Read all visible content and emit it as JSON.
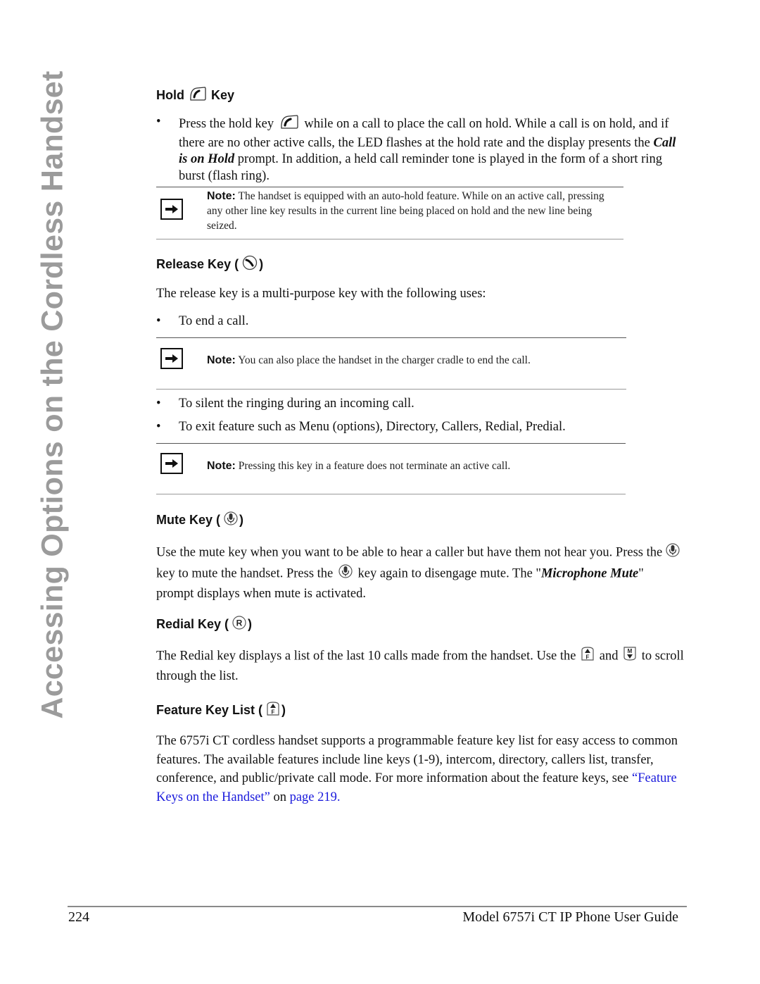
{
  "side_title": "Accessing Options on the Cordless Handset",
  "sections": {
    "hold": {
      "heading_prefix": "Hold",
      "heading_suffix": "Key",
      "icon": "hold-phone-icon",
      "bullet": {
        "before_icon": "Press the hold key",
        "after_icon": "while on a call to place the call on hold. While a call is on hold, and if there are no other active calls, the LED flashes at the hold rate and the display presents the",
        "emphasis": "Call is on Hold",
        "after_emphasis": "prompt. In addition, a held call reminder tone is played in the form of a short ring burst (flash ring)."
      },
      "note": {
        "label": "Note:",
        "text": "The handset is equipped with an auto-hold feature. While on an active call, pressing any other line key results in the current line being placed on hold and the new line being seized."
      }
    },
    "release": {
      "heading_prefix": "Release Key (",
      "heading_suffix": ")",
      "icon": "release-phone-icon",
      "intro": "The release key is a multi-purpose key with the following uses:",
      "bullets": [
        "To end a call.",
        "To silent the ringing during an incoming call.",
        "To exit feature such as Menu (options), Directory, Callers, Redial, Predial."
      ],
      "notes": [
        {
          "label": "Note:",
          "text": "You can also place the handset in the charger cradle to end the call."
        },
        {
          "label": "Note:",
          "text": "Pressing this key in a feature does not terminate an active call."
        }
      ]
    },
    "mute": {
      "heading_prefix": "Mute Key (",
      "heading_suffix": ")",
      "icon": "microphone-mute-icon",
      "p1": "Use the mute key when you want to be able to hear a caller but have them not hear you. Press the",
      "p2": "key to mute the handset. Press the",
      "p3": "key again to disengage mute. The \"",
      "emphasis": "Microphone Mute",
      "p4": "\" prompt displays when mute is activated."
    },
    "redial": {
      "heading_prefix": "Redial Key (",
      "heading_suffix": ")",
      "icon": "redial-r-icon",
      "p1": "The Redial key displays a list of the last 10 calls made from the handset.  Use the",
      "p2": "and",
      "p3": "to scroll through the list."
    },
    "feature": {
      "heading_prefix": "Feature Key List (",
      "heading_suffix": ")",
      "icon": "feature-up-icon",
      "text": "The 6757i CT cordless handset supports a programmable feature key list for easy access to common features. The available features include line keys (1-9), intercom, directory, callers list, transfer, conference, and public/private call mode. For more information about the feature keys, see",
      "link_text": "“Feature Keys on the Handset”",
      "link_mid": "on",
      "link_page": "page 219",
      "end": "."
    }
  },
  "footer": {
    "page_number": "224",
    "guide_title": "Model 6757i CT IP Phone User Guide"
  },
  "colors": {
    "side_title": "#9b9b9b",
    "link": "#1a1adc",
    "text": "#111111"
  }
}
